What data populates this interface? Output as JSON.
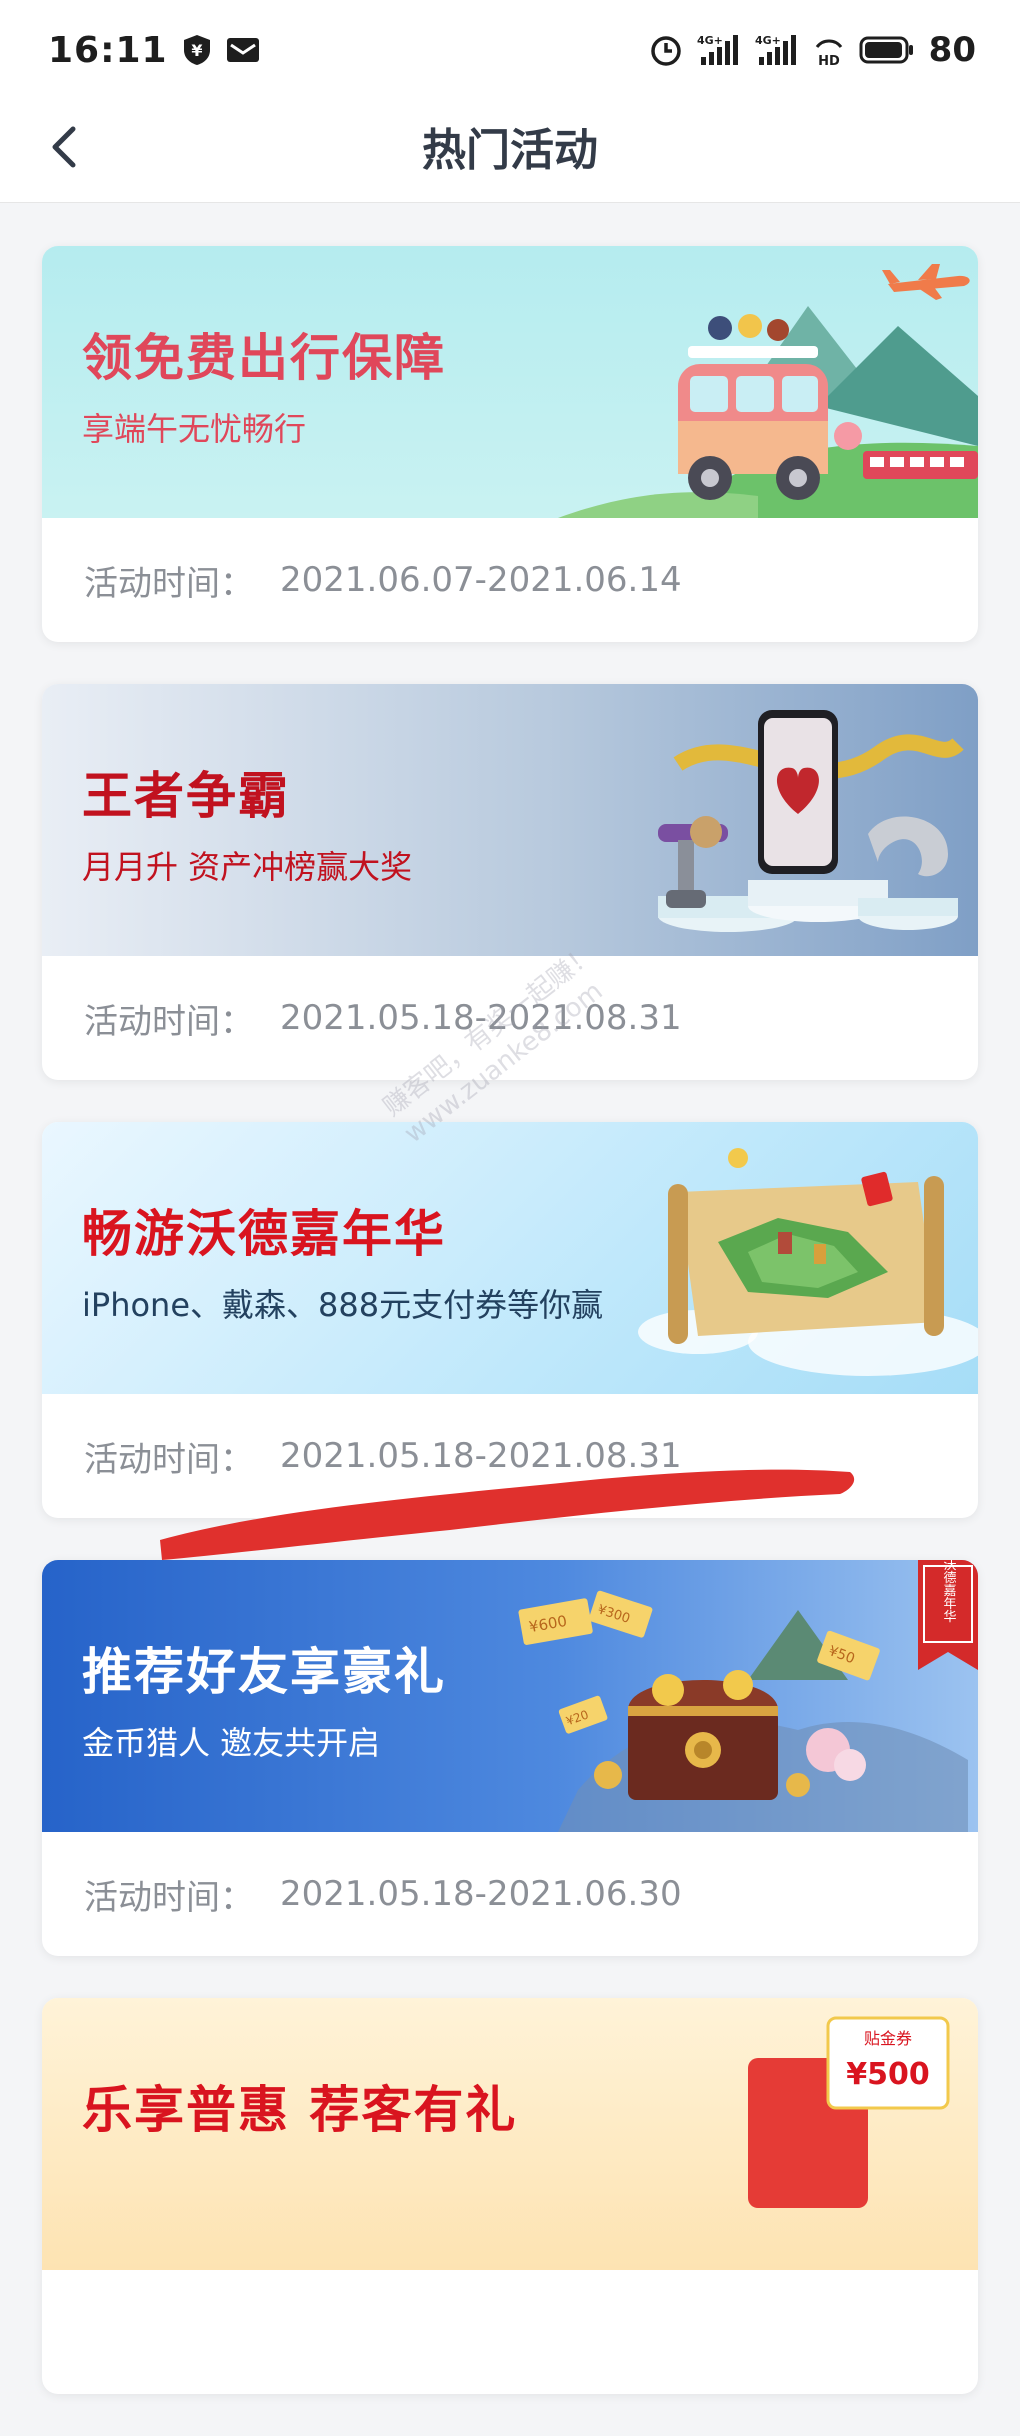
{
  "status_bar": {
    "time": "16:11",
    "battery": "80",
    "icons": [
      "yuan-shield-icon",
      "mail-icon",
      "alarm-icon",
      "signal-4g-icon",
      "signal-4g-icon",
      "hd-icon",
      "battery-icon"
    ]
  },
  "nav": {
    "title": "热门活动",
    "back_icon": "chevron-left-icon"
  },
  "activities": [
    {
      "title": "领免费出行保障",
      "subtitle": "享端午无忧畅行",
      "time_label": "活动时间：",
      "time_value": "2021.06.07-2021.06.14",
      "title_color": "#e0475a",
      "subtitle_color": "#e0475a",
      "art": "camper-van-mountains-plane"
    },
    {
      "title": "王者争霸",
      "subtitle": "月月升  资产冲榜赢大奖",
      "time_label": "活动时间：",
      "time_value": "2021.05.18-2021.08.31",
      "title_color": "#c1121f",
      "subtitle_color": "#c1121f",
      "art": "phone-vacuum-prizes"
    },
    {
      "title": "畅游沃德嘉年华",
      "subtitle": "iPhone、戴森、888元支付券等你赢",
      "time_label": "活动时间：",
      "time_value": "2021.05.18-2021.08.31",
      "title_color": "#d9141f",
      "subtitle_color": "#23415f",
      "art": "treasure-map-scroll"
    },
    {
      "title": "推荐好友享豪礼",
      "subtitle": "金币猎人  邀友共开启",
      "time_label": "活动时间：",
      "time_value": "2021.05.18-2021.06.30",
      "title_color": "#ffffff",
      "subtitle_color": "#ffffff",
      "art": "treasure-chest-coupons",
      "badge": "沃德嘉年华",
      "coupon_labels": [
        "¥600",
        "¥300",
        "¥50",
        "¥20"
      ]
    },
    {
      "title": "乐享普惠  荐客有礼",
      "time_label": "",
      "time_value": "",
      "title_color": "#d9141f",
      "art": "red-envelope-coupon",
      "coupon_label": "贴金券",
      "coupon_value": "¥500"
    }
  ],
  "watermark": {
    "line1": "赚客吧，有奖一起赚！",
    "line2": "www.zuanke8.com"
  },
  "annotation_color": "#e0302d"
}
